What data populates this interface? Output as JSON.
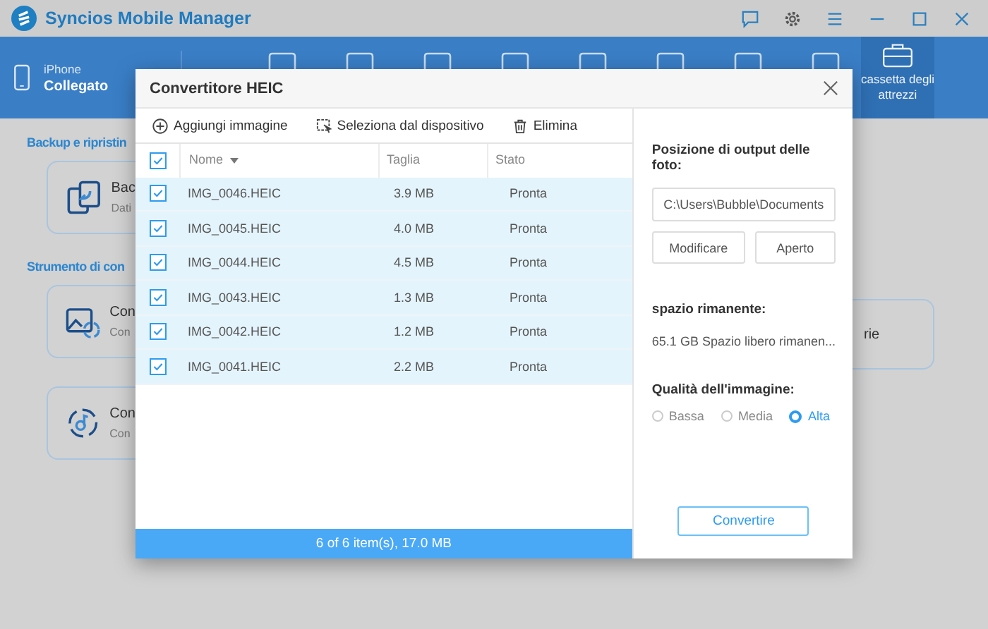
{
  "window": {
    "title": "Syncios Mobile Manager"
  },
  "device": {
    "name": "iPhone",
    "status": "Collegato"
  },
  "nav": {
    "toolbox": {
      "label": "cassetta degli attrezzi",
      "selected": true
    }
  },
  "sections": [
    {
      "heading": "Backup e ripristin",
      "cards": [
        {
          "title": "Bac",
          "subtitle": "Dati"
        }
      ]
    },
    {
      "heading": "Strumento di con",
      "cards": [
        {
          "title": "Con",
          "subtitle": "Con"
        },
        {
          "title": "Con",
          "subtitle": "Con"
        }
      ]
    }
  ],
  "side_card": {
    "text": "rie"
  },
  "dialog": {
    "title": "Convertitore HEIC",
    "toolbar": [
      {
        "kind": "add",
        "label": "Aggiungi immagine"
      },
      {
        "kind": "device",
        "label": "Seleziona dal dispositivo"
      },
      {
        "kind": "delete",
        "label": "Elimina"
      }
    ],
    "select_all": {
      "checked": true
    },
    "columns": [
      "Nome",
      "Taglia",
      "Stato"
    ],
    "rows": [
      {
        "checked": true,
        "name": "IMG_0046.HEIC",
        "size": "3.9 MB",
        "status": "Pronta"
      },
      {
        "checked": true,
        "name": "IMG_0045.HEIC",
        "size": "4.0 MB",
        "status": "Pronta"
      },
      {
        "checked": true,
        "name": "IMG_0044.HEIC",
        "size": "4.5 MB",
        "status": "Pronta"
      },
      {
        "checked": true,
        "name": "IMG_0043.HEIC",
        "size": "1.3 MB",
        "status": "Pronta"
      },
      {
        "checked": true,
        "name": "IMG_0042.HEIC",
        "size": "1.2 MB",
        "status": "Pronta"
      },
      {
        "checked": true,
        "name": "IMG_0041.HEIC",
        "size": "2.2 MB",
        "status": "Pronta"
      }
    ],
    "footer": "6 of 6 item(s), 17.0 MB",
    "output_label": "Posizione di output delle foto:",
    "output_path": "C:\\Users\\Bubble\\Documents",
    "path_buttons": [
      "Modificare",
      "Aperto"
    ],
    "space_label": "spazio rimanente:",
    "space_value": "65.1 GB Spazio libero rimanen...",
    "quality_label": "Qualità dell'immagine:",
    "quality_options": [
      {
        "label": "Bassa",
        "selected": false
      },
      {
        "label": "Media",
        "selected": false
      },
      {
        "label": "Alta",
        "selected": true
      }
    ],
    "convert_button": "Convertire"
  }
}
